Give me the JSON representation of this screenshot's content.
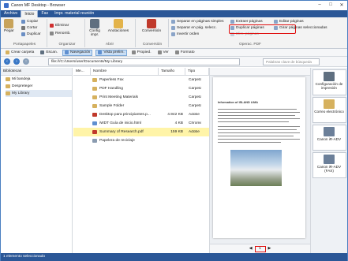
{
  "app": {
    "title": "Canon MF Desktop - Browser"
  },
  "window_buttons": [
    "–",
    "□",
    "✕"
  ],
  "ribbon_tabs": [
    "Archivo",
    "Inicio",
    "Fax",
    "Impr. material reunión"
  ],
  "ribbon": {
    "paste": "Pegar",
    "copy": "Copiar",
    "cut": "Cortar",
    "duplicate": "Duplicar",
    "group_portapapeles": "Portapapeles",
    "delete": "Eliminar",
    "rename": "Renomb.",
    "group_organizar": "Organizar",
    "config": "Config impr.",
    "annotations": "Anotaciones",
    "group_abrir": "Abrir",
    "conversion": "Conversión",
    "group_conversion": "Conversión",
    "separate_simple": "Separar en páginas simples",
    "separate_select": "Separar en pág. selecc.",
    "reverse": "Invertir orden",
    "extract": "Extraer páginas",
    "duplicate_pages": "Duplicar páginas",
    "delete_pages": "Elim. páginas",
    "edit_pages": "Editar páginas",
    "rotate_pages": "Girar páginas seleccionadas",
    "group_pdf": "Operac. PDF"
  },
  "toolbar": {
    "create_folder": "Crear carpeta",
    "scan": "Escan.",
    "navigation": "Navegación",
    "preview": "Vista prelim.",
    "properties": "Propied.",
    "view": "Ver",
    "format": "Formato"
  },
  "address": {
    "path": "file:///C:/Users/user/Documents/My Library",
    "search_placeholder": "Palabras clave de búsqueda"
  },
  "tree": {
    "header": "Bibliotecas",
    "items": [
      "Mi bandeja",
      "Despreteger",
      "My Library"
    ]
  },
  "list": {
    "headers": [
      "Me...",
      "Nombre",
      "Tamaño",
      "Tipo"
    ],
    "rows": [
      {
        "name": "Paperless Fax",
        "size": "",
        "type": "Carpeta"
      },
      {
        "name": "PDF Handling",
        "size": "",
        "type": "Carpeta"
      },
      {
        "name": "Print Meeting Materials",
        "size": "",
        "type": "Carpeta"
      },
      {
        "name": "Sample Folder",
        "size": "",
        "type": "Carpeta"
      },
      {
        "name": "Desktop para principiantes.p...",
        "size": "4.942 KB",
        "type": "Adobe"
      },
      {
        "name": "iWDT Guía de inicio.html",
        "size": "4 KB",
        "type": "Chrome"
      },
      {
        "name": "Summary of Research.pdf",
        "size": "159 KB",
        "type": "Adobe"
      },
      {
        "name": "Papelera de reciclaje",
        "size": "",
        "type": ""
      }
    ]
  },
  "preview": {
    "doc_title": "Information of ISLAND LIMA",
    "page_number": "1"
  },
  "right_panel": [
    {
      "label": "Configuración de impresión"
    },
    {
      "label": "Correo electrónico"
    },
    {
      "label": "Canon iR-ADV"
    },
    {
      "label": "Canon iR-ADV (FAX)"
    }
  ],
  "status": "1 elemento seleccionado",
  "colors": {
    "accent": "#2b5797",
    "highlight": "#e01010",
    "selected_row": "#fff4a8"
  }
}
